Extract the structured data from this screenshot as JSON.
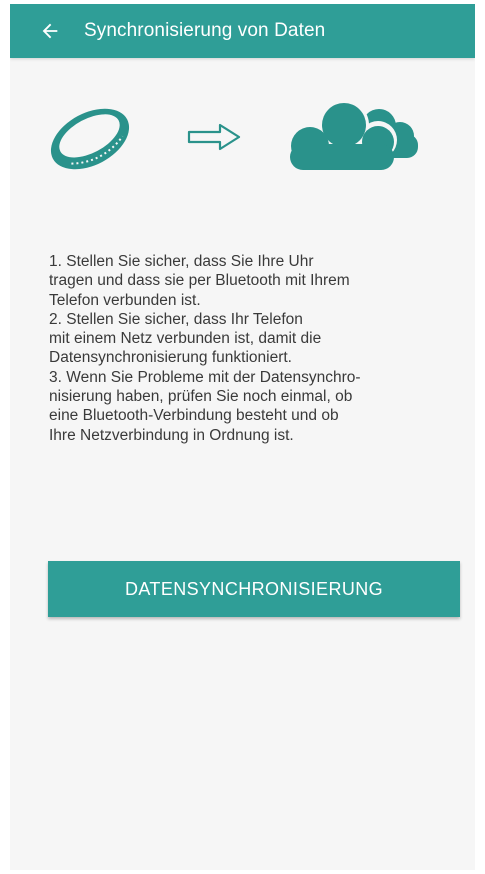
{
  "appbar": {
    "title": "Synchronisierung von Daten",
    "back_icon": "arrow-left-icon",
    "color": "#2f9e97"
  },
  "hero": {
    "band_icon": "fitness-band-icon",
    "arrow_icon": "arrow-right-outline-icon",
    "cloud_icon": "cloud-icon",
    "icon_color": "#2a928b"
  },
  "instructions": {
    "lines": [
      "1. Stellen Sie sicher, dass Sie Ihre Uhr",
      "tragen und dass sie per Bluetooth mit Ihrem",
      "Telefon verbunden ist.",
      "2. Stellen Sie sicher, dass Ihr Telefon",
      "mit einem Netz verbunden ist, damit die",
      "Datensynchronisierung funktioniert.",
      "3. Wenn Sie Probleme mit der Datensynchro-",
      "nisierung haben, prüfen Sie noch einmal, ob",
      "eine Bluetooth-Verbindung besteht und ob",
      "Ihre Netzverbindung in Ordnung ist."
    ]
  },
  "sync_button": {
    "label": "DATENSYNCHRONISIERUNG"
  }
}
